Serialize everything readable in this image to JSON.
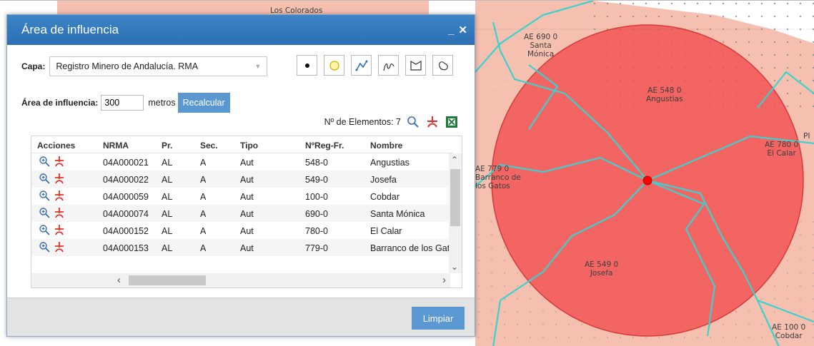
{
  "dialog": {
    "title": "Área de influencia",
    "minimize_label": "_",
    "close_label": "✕",
    "layer_label": "Capa:",
    "layer_value": "Registro Minero de Andalucía. RMA",
    "buffer_label": "Área de influencia:",
    "buffer_value": "300",
    "units_label": "metros",
    "recalc_label": "Recalcular",
    "count_label": "Nº de Elementos: 7",
    "clear_label": "Limpiar",
    "geometry_tools": [
      "point-icon",
      "circle-icon",
      "polyline-icon",
      "freehand-icon",
      "polygon-icon",
      "freehand-polygon-icon"
    ]
  },
  "table": {
    "headers": [
      "Acciones",
      "NRMA",
      "Pr.",
      "Sec.",
      "Tipo",
      "NºReg-Fr.",
      "Nombre"
    ],
    "rows": [
      {
        "nrma": "04A000021",
        "pr": "AL",
        "sec": "A",
        "tipo": "Aut",
        "reg": "548-0",
        "nombre": "Angustias"
      },
      {
        "nrma": "04A000022",
        "pr": "AL",
        "sec": "A",
        "tipo": "Aut",
        "reg": "549-0",
        "nombre": "Josefa"
      },
      {
        "nrma": "04A000059",
        "pr": "AL",
        "sec": "A",
        "tipo": "Aut",
        "reg": "100-0",
        "nombre": "Cobdar"
      },
      {
        "nrma": "04A000074",
        "pr": "AL",
        "sec": "A",
        "tipo": "Aut",
        "reg": "690-0",
        "nombre": "Santa Mónica"
      },
      {
        "nrma": "04A000152",
        "pr": "AL",
        "sec": "A",
        "tipo": "Aut",
        "reg": "780-0",
        "nombre": "El Calar"
      },
      {
        "nrma": "04A000153",
        "pr": "AL",
        "sec": "A",
        "tipo": "Aut",
        "reg": "779-0",
        "nombre": "Barranco de los Gatos"
      }
    ]
  },
  "map": {
    "labels": [
      {
        "l1": "Los Colorados",
        "l2": ""
      },
      {
        "l1": "AE 690 0",
        "l2": "Santa",
        "l3": "Mónica"
      },
      {
        "l1": "AE 548 0",
        "l2": "Angustias"
      },
      {
        "l1": "AE 779 0",
        "l2": "Barranco de",
        "l3": "los Gatos"
      },
      {
        "l1": "AE 780 0",
        "l2": "El Calar"
      },
      {
        "l1": "AE 549 0",
        "l2": "Josefa"
      },
      {
        "l1": "AE 100 0",
        "l2": "Cobdar"
      },
      {
        "l1": "PI",
        "l2": ""
      }
    ]
  },
  "colors": {
    "header_blue": "#3479bd",
    "button_blue": "#5b97d1",
    "buffer_fill": "#f24b4b",
    "parcel_fill": "#f6c0b0",
    "parcel_outline": "#3cd1cf",
    "center_point": "#ff0000"
  }
}
